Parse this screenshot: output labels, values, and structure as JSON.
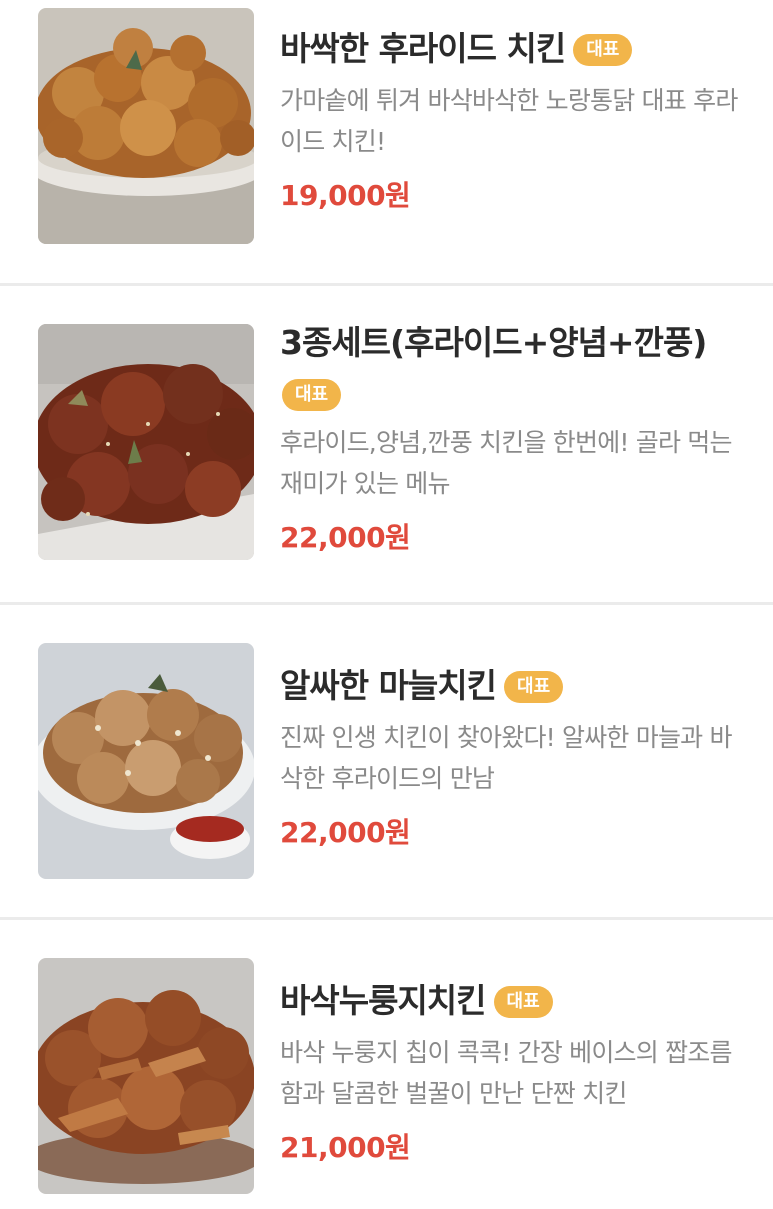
{
  "badge_color": "#f2b54a",
  "price_color": "#e04a3c",
  "menu": [
    {
      "name": "바싹한 후라이드 치킨",
      "badge": "대표",
      "description": "가마솥에 튀겨 바삭바삭한 노랑통닭 대표 후라이드 치킨!",
      "price": "19,000원",
      "image_icon": "fried-chicken-photo"
    },
    {
      "name": "3종세트(후라이드+양념+깐풍)",
      "badge": "대표",
      "description": "후라이드,양념,깐풍 치킨을 한번에! 골라 먹는 재미가 있는 메뉴",
      "price": "22,000원",
      "image_icon": "seasoned-chicken-photo"
    },
    {
      "name": "알싸한 마늘치킨",
      "badge": "대표",
      "description": "진짜 인생 치킨이 찾아왔다! 알싸한 마늘과 바삭한 후라이드의 만남",
      "price": "22,000원",
      "image_icon": "garlic-chicken-photo"
    },
    {
      "name": "바삭누룽지치킨",
      "badge": "대표",
      "description": "바삭 누룽지 칩이 콕콕! 간장 베이스의 짭조름함과 달콤한 벌꿀이 만난 단짠 치킨",
      "price": "21,000원",
      "image_icon": "nurungji-chicken-photo"
    }
  ]
}
